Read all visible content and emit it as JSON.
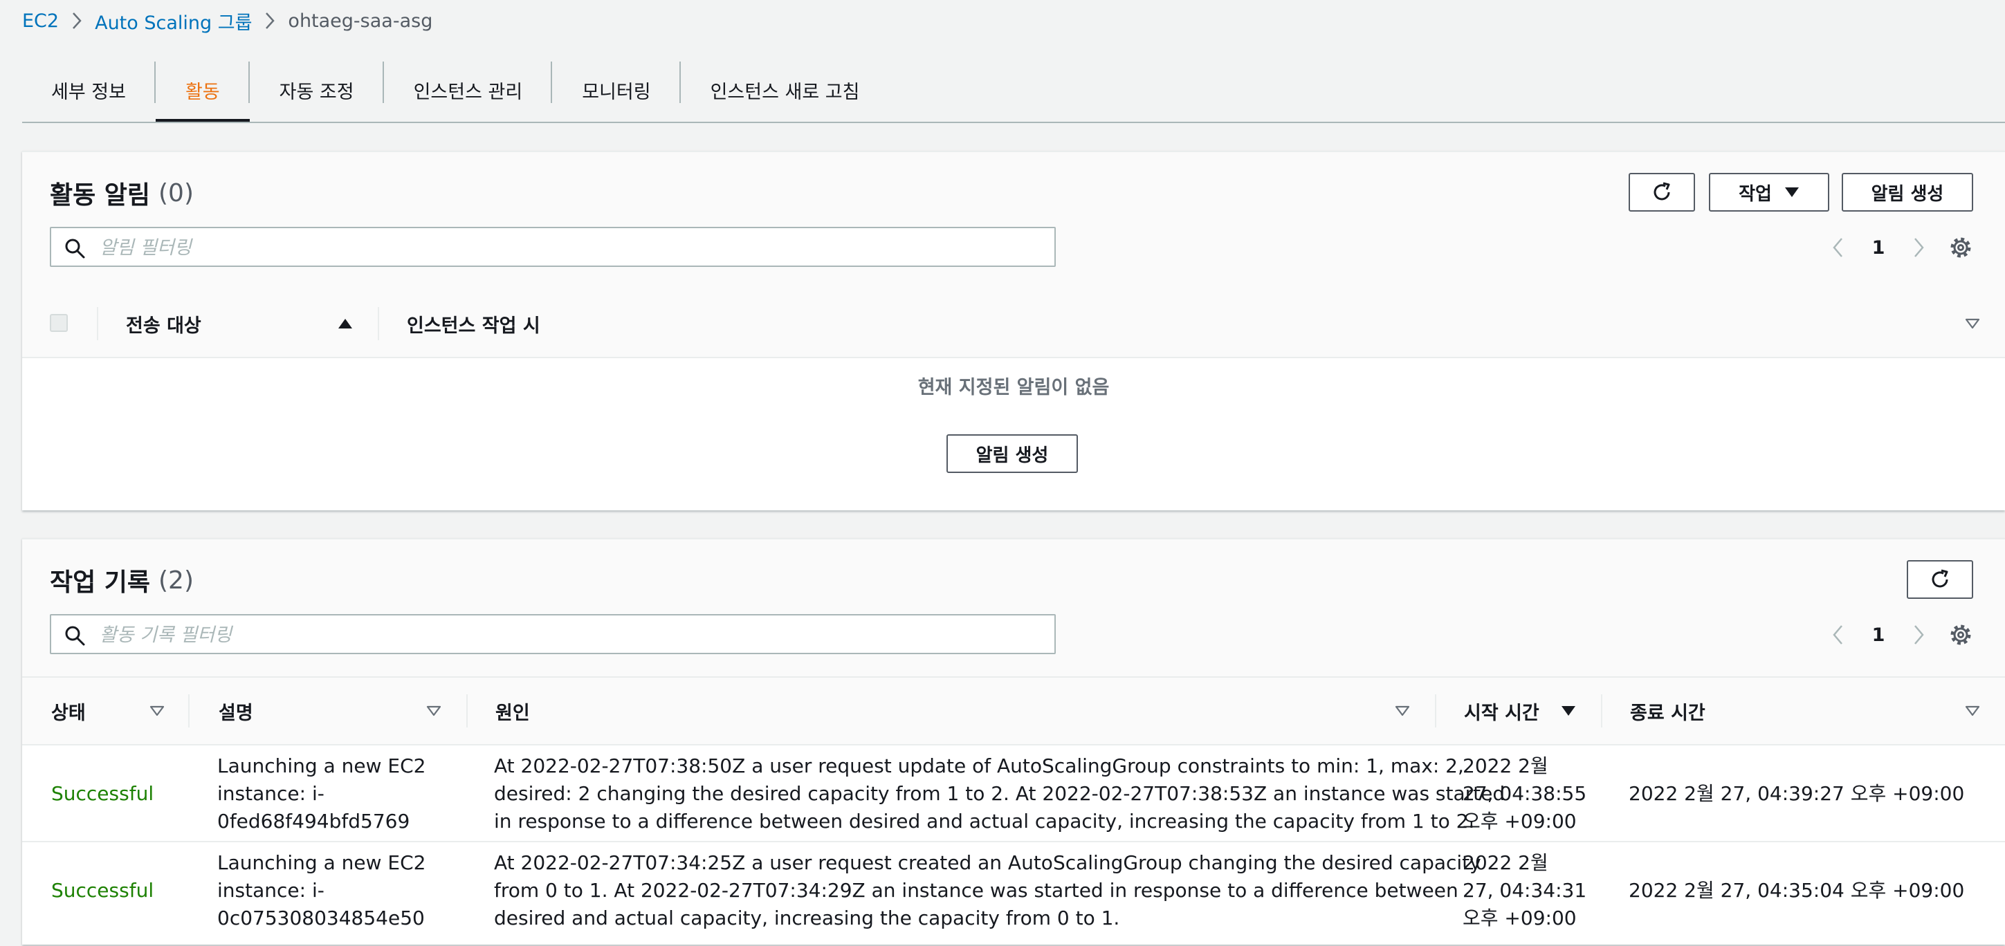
{
  "breadcrumb": {
    "items": [
      {
        "label": "EC2"
      },
      {
        "label": "Auto Scaling 그룹"
      },
      {
        "label": "ohtaeg-saa-asg"
      }
    ]
  },
  "tabs": [
    {
      "label": "세부 정보",
      "active": false
    },
    {
      "label": "활동",
      "active": true
    },
    {
      "label": "자동 조정",
      "active": false
    },
    {
      "label": "인스턴스 관리",
      "active": false
    },
    {
      "label": "모니터링",
      "active": false
    },
    {
      "label": "인스턴스 새로 고침",
      "active": false
    }
  ],
  "alarms": {
    "title": "활동 알림",
    "count": "(0)",
    "actions_label": "작업",
    "create_label": "알림 생성",
    "search_placeholder": "알림 필터링",
    "page": "1",
    "columns": [
      "전송 대상",
      "인스턴스 작업 시"
    ],
    "empty_message": "현재 지정된 알림이 없음",
    "empty_create_label": "알림 생성"
  },
  "history": {
    "title": "작업 기록",
    "count": "(2)",
    "search_placeholder": "활동 기록 필터링",
    "page": "1",
    "columns": [
      "상태",
      "설명",
      "원인",
      "시작 시간",
      "종료 시간"
    ],
    "rows": [
      {
        "status": "Successful",
        "description": [
          "Launching a new EC2",
          "instance: i-",
          "0fed68f494bfd5769"
        ],
        "cause": [
          "At 2022-02-27T07:38:50Z a user request update of AutoScalingGroup constraints to min: 1, max: 2,",
          "desired: 2 changing the desired capacity from 1 to 2. At 2022-02-27T07:38:53Z an instance was started",
          "in response to a difference between desired and actual capacity, increasing the capacity from 1 to 2."
        ],
        "start": [
          "2022 2월",
          "27, 04:38:55",
          "오후 +09:00"
        ],
        "end": "2022 2월 27, 04:39:27 오후 +09:00"
      },
      {
        "status": "Successful",
        "description": [
          "Launching a new EC2",
          "instance: i-",
          "0c075308034854e50"
        ],
        "cause": [
          "At 2022-02-27T07:34:25Z a user request created an AutoScalingGroup changing the desired capacity",
          "from 0 to 1. At 2022-02-27T07:34:29Z an instance was started in response to a difference between",
          "desired and actual capacity, increasing the capacity from 0 to 1."
        ],
        "start": [
          "2022 2월",
          "27, 04:34:31",
          "오후 +09:00"
        ],
        "end": "2022 2월 27, 04:35:04 오후 +09:00"
      }
    ]
  },
  "colors": {
    "link": "#0073bb",
    "active_tab": "#ec7211",
    "success": "#1d8102",
    "border": "#eaeded",
    "muted_text": "#545b64"
  },
  "icons": [
    "chevron-right-icon",
    "refresh-icon",
    "caret-down-icon",
    "search-icon",
    "chevron-left-icon",
    "gear-icon",
    "sort-ascending-icon",
    "sort-descending-icon",
    "sortable-icon"
  ]
}
